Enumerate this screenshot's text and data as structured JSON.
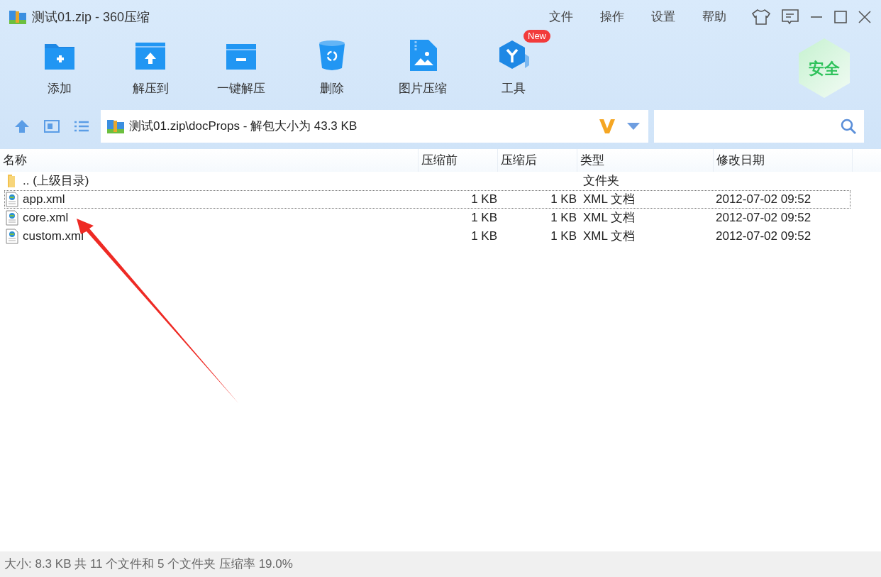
{
  "window": {
    "title": "测试01.zip - 360压缩"
  },
  "menu": [
    "文件",
    "操作",
    "设置",
    "帮助"
  ],
  "toolbar": [
    {
      "label": "添加",
      "kind": "add"
    },
    {
      "label": "解压到",
      "kind": "extract"
    },
    {
      "label": "一键解压",
      "kind": "quick"
    },
    {
      "label": "删除",
      "kind": "delete"
    },
    {
      "label": "图片压缩",
      "kind": "image"
    },
    {
      "label": "工具",
      "kind": "tools",
      "badge": "New"
    }
  ],
  "security_badge": "安全",
  "address_bar": {
    "path": "测试01.zip\\docProps - 解包大小为 43.3 KB"
  },
  "table": {
    "columns": [
      "名称",
      "压缩前",
      "压缩后",
      "类型",
      "修改日期"
    ],
    "rows": [
      {
        "kind": "folder",
        "name": ".. (上级目录)",
        "type": "文件夹",
        "selected": false
      },
      {
        "kind": "file",
        "name": "app.xml",
        "original_size": "1 KB",
        "packed_size": "1 KB",
        "type": "XML 文档",
        "modified": "2012-07-02 09:52",
        "selected": true
      },
      {
        "kind": "file",
        "name": "core.xml",
        "original_size": "1 KB",
        "packed_size": "1 KB",
        "type": "XML 文档",
        "modified": "2012-07-02 09:52",
        "selected": false
      },
      {
        "kind": "file",
        "name": "custom.xml",
        "original_size": "1 KB",
        "packed_size": "1 KB",
        "type": "XML 文档",
        "modified": "2012-07-02 09:52",
        "selected": false
      }
    ]
  },
  "status_bar": "大小: 8.3 KB 共 11 个文件和 5 个文件夹 压缩率 19.0%"
}
